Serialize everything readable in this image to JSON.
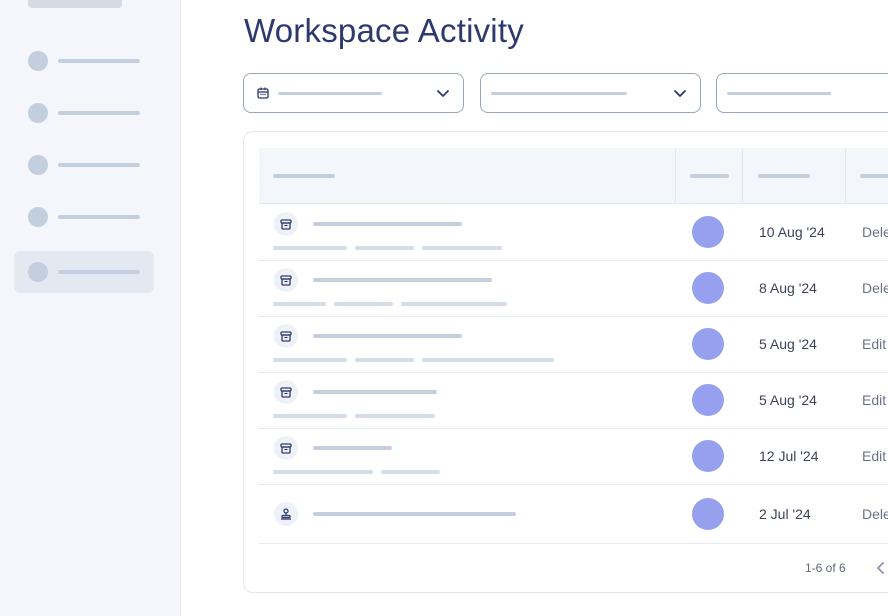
{
  "page": {
    "title": "Workspace Activity"
  },
  "sidebar": {
    "items": [
      {
        "icon": "nav-placeholder-icon",
        "active": false
      },
      {
        "icon": "nav-placeholder-icon",
        "active": false
      },
      {
        "icon": "nav-placeholder-icon",
        "active": false
      },
      {
        "icon": "nav-placeholder-icon",
        "active": false
      },
      {
        "icon": "nav-placeholder-icon",
        "active": true
      }
    ]
  },
  "filters": [
    {
      "icon": "calendar-icon",
      "chevron": "chevron-down-icon"
    },
    {
      "icon": null,
      "chevron": "chevron-down-icon"
    },
    {
      "icon": null,
      "chevron": null
    }
  ],
  "table": {
    "rows": [
      {
        "icon": "archive-icon",
        "date": "10 Aug '24",
        "action": "Dele"
      },
      {
        "icon": "archive-icon",
        "date": "8 Aug '24",
        "action": "Dele"
      },
      {
        "icon": "archive-icon",
        "date": "5 Aug '24",
        "action": "Edit"
      },
      {
        "icon": "archive-icon",
        "date": "5 Aug '24",
        "action": "Edit"
      },
      {
        "icon": "archive-icon",
        "date": "12 Jul '24",
        "action": "Edit"
      },
      {
        "icon": "stamp-icon",
        "date": "2 Jul '24",
        "action": "Dele"
      }
    ]
  },
  "pagination": {
    "range": "1-6 of 6",
    "prev_icon": "chevron-left-icon"
  },
  "colors": {
    "accent": "#2e3a6e",
    "avatar": "#97a0ee",
    "placeholder": "#c3cfde",
    "sidebar_bg": "#f4f6fb"
  }
}
